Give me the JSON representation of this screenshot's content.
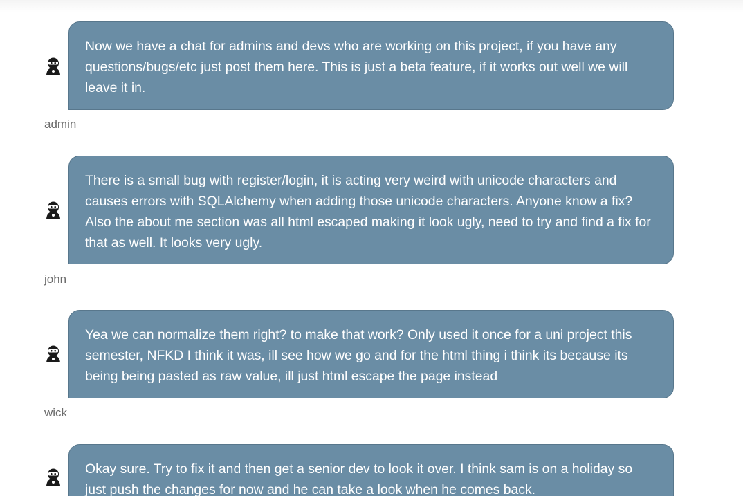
{
  "messages": [
    {
      "author": "admin",
      "text": "Now we have a chat for admins and devs who are working on this project, if you have any questions/bugs/etc just post them here. This is just a beta feature, if it works out well we will leave it in."
    },
    {
      "author": "john",
      "text": "There is a small bug with register/login, it is acting very weird with unicode characters and causes errors with SQLAlchemy when adding those unicode characters. Anyone know a fix? Also the about me section was all html escaped making it look ugly, need to try and find a fix for that as well. It looks very ugly."
    },
    {
      "author": "wick",
      "text": "Yea we can normalize them right? to make that work? Only used it once for a uni project this semester, NFKD I think it was, ill see how we go and for the html thing i think its because its being being pasted as raw value, ill just html escape the page instead"
    },
    {
      "author": "",
      "text": "Okay sure. Try to fix it and then get a senior dev to look it over. I think sam is on a holiday so just push the changes for now and he can take a look when he comes back."
    }
  ],
  "colors": {
    "bubble": "#6a8da5",
    "bubble_text": "#ffffff",
    "author_text": "#6b6b6b"
  },
  "icons": {
    "avatar": "ninja-avatar-icon"
  }
}
